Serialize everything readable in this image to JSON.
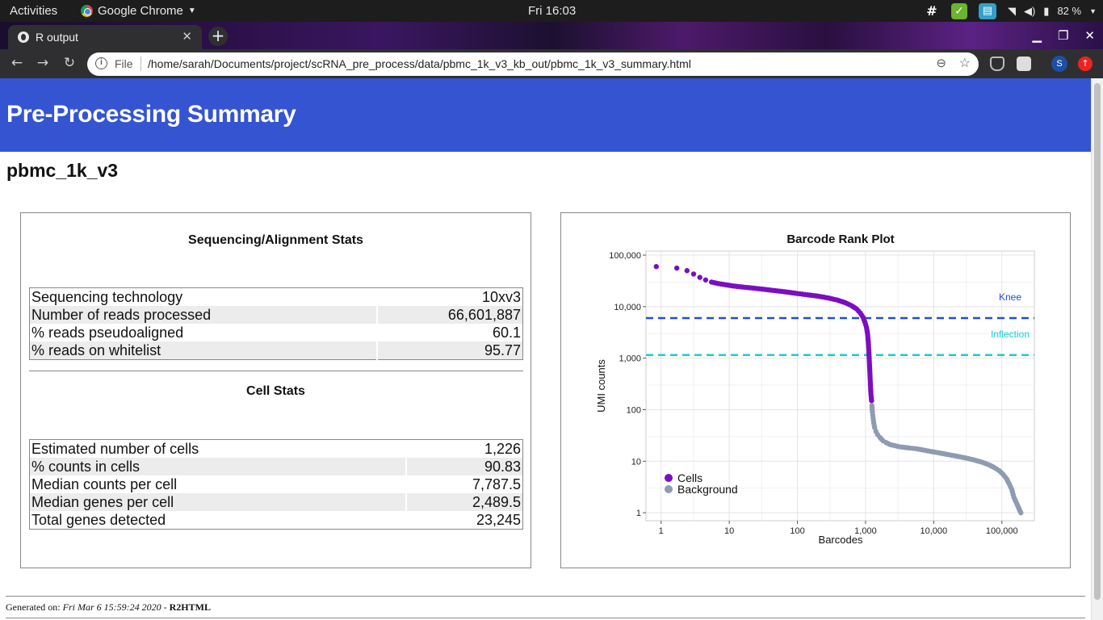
{
  "system": {
    "activities": "Activities",
    "app_name": "Google Chrome",
    "clock": "Fri 16:03",
    "battery": "82 %"
  },
  "browser": {
    "tab_title": "R output",
    "file_label": "File",
    "url": "/home/sarah/Documents/project/scRNA_pre_process/data/pbmc_1k_v3_kb_out/pbmc_1k_v3_summary.html",
    "avatar_letter": "S"
  },
  "page": {
    "header": "Pre-Processing Summary",
    "sample": "pbmc_1k_v3",
    "seq_section_title": "Sequencing/Alignment Stats",
    "seq_stats": [
      {
        "label": "Sequencing technology",
        "value": "10xv3"
      },
      {
        "label": "Number of reads processed",
        "value": "66,601,887"
      },
      {
        "label": "% reads pseudoaligned",
        "value": "60.1"
      },
      {
        "label": "% reads on whitelist",
        "value": "95.77"
      }
    ],
    "cell_section_title": "Cell Stats",
    "cell_stats": [
      {
        "label": "Estimated number of cells",
        "value": "1,226"
      },
      {
        "label": "% counts in cells",
        "value": "90.83"
      },
      {
        "label": "Median counts per cell",
        "value": "7,787.5"
      },
      {
        "label": "Median genes per cell",
        "value": "2,489.5"
      },
      {
        "label": "Total genes detected",
        "value": "23,245"
      }
    ],
    "footer_prefix": "Generated on: ",
    "footer_date": "Fri Mar 6 15:59:24 2020",
    "footer_sep": " - ",
    "footer_tool": "R2HTML"
  },
  "chart_data": {
    "type": "scatter",
    "title": "Barcode Rank Plot",
    "xlabel": "Barcodes",
    "ylabel": "UMI counts",
    "x_scale": "log10",
    "y_scale": "log10",
    "xlim": [
      0.6,
      300000
    ],
    "ylim": [
      0.7,
      120000
    ],
    "x_ticks": [
      {
        "v": 1,
        "label": "1"
      },
      {
        "v": 10,
        "label": "10"
      },
      {
        "v": 100,
        "label": "100"
      },
      {
        "v": 1000,
        "label": "1,000"
      },
      {
        "v": 10000,
        "label": "10,000"
      },
      {
        "v": 100000,
        "label": "100,000"
      }
    ],
    "y_ticks": [
      {
        "v": 1,
        "label": "1"
      },
      {
        "v": 10,
        "label": "10"
      },
      {
        "v": 100,
        "label": "100"
      },
      {
        "v": 1000,
        "label": "1,000"
      },
      {
        "v": 10000,
        "label": "10,000"
      },
      {
        "v": 100000,
        "label": "100,000"
      }
    ],
    "grid": true,
    "legend_position": "bottom-left",
    "series": [
      {
        "name": "Cells",
        "color": "#7b0ec1",
        "points": [
          [
            0.85,
            60000
          ],
          [
            1.7,
            56000
          ],
          [
            2.4,
            50000
          ],
          [
            3.0,
            43000
          ],
          [
            3.7,
            37000
          ],
          [
            4.5,
            33000
          ],
          [
            5.5,
            30000
          ],
          [
            7,
            28000
          ],
          [
            9,
            26500
          ],
          [
            12,
            25000
          ],
          [
            16,
            24000
          ],
          [
            22,
            23000
          ],
          [
            30,
            22000
          ],
          [
            40,
            21000
          ],
          [
            55,
            20000
          ],
          [
            75,
            19000
          ],
          [
            100,
            18000
          ],
          [
            140,
            17000
          ],
          [
            200,
            16000
          ],
          [
            280,
            14800
          ],
          [
            380,
            13500
          ],
          [
            500,
            12000
          ],
          [
            620,
            10500
          ],
          [
            740,
            9000
          ],
          [
            840,
            7500
          ],
          [
            920,
            6200
          ],
          [
            980,
            5000
          ],
          [
            1030,
            4000
          ],
          [
            1070,
            3000
          ],
          [
            1100,
            2000
          ],
          [
            1120,
            1300
          ],
          [
            1140,
            800
          ],
          [
            1160,
            500
          ],
          [
            1180,
            300
          ],
          [
            1200,
            200
          ],
          [
            1226,
            150
          ]
        ]
      },
      {
        "name": "Background",
        "color": "#8e9bb0",
        "points": [
          [
            1240,
            120
          ],
          [
            1260,
            90
          ],
          [
            1290,
            70
          ],
          [
            1320,
            55
          ],
          [
            1360,
            45
          ],
          [
            1420,
            38
          ],
          [
            1500,
            33
          ],
          [
            1620,
            29
          ],
          [
            1800,
            25
          ],
          [
            2000,
            23
          ],
          [
            2300,
            21
          ],
          [
            2700,
            20
          ],
          [
            3200,
            19
          ],
          [
            3800,
            18.5
          ],
          [
            4500,
            18
          ],
          [
            5500,
            17.5
          ],
          [
            7000,
            16.5
          ],
          [
            9000,
            15.5
          ],
          [
            12000,
            14.5
          ],
          [
            16000,
            13.5
          ],
          [
            22000,
            12.5
          ],
          [
            30000,
            11.5
          ],
          [
            40000,
            10.5
          ],
          [
            52000,
            9.5
          ],
          [
            65000,
            8.5
          ],
          [
            78000,
            7.5
          ],
          [
            92000,
            6.5
          ],
          [
            105000,
            5.5
          ],
          [
            118000,
            4.5
          ],
          [
            130000,
            3.5
          ],
          [
            140000,
            2.8
          ],
          [
            150000,
            2.0
          ],
          [
            190000,
            1.0
          ]
        ]
      }
    ],
    "hlines": [
      {
        "label": "Knee",
        "y": 6000,
        "color": "#1f4fd6"
      },
      {
        "label": "Inflection",
        "y": 1150,
        "color": "#14cfd6"
      }
    ]
  }
}
